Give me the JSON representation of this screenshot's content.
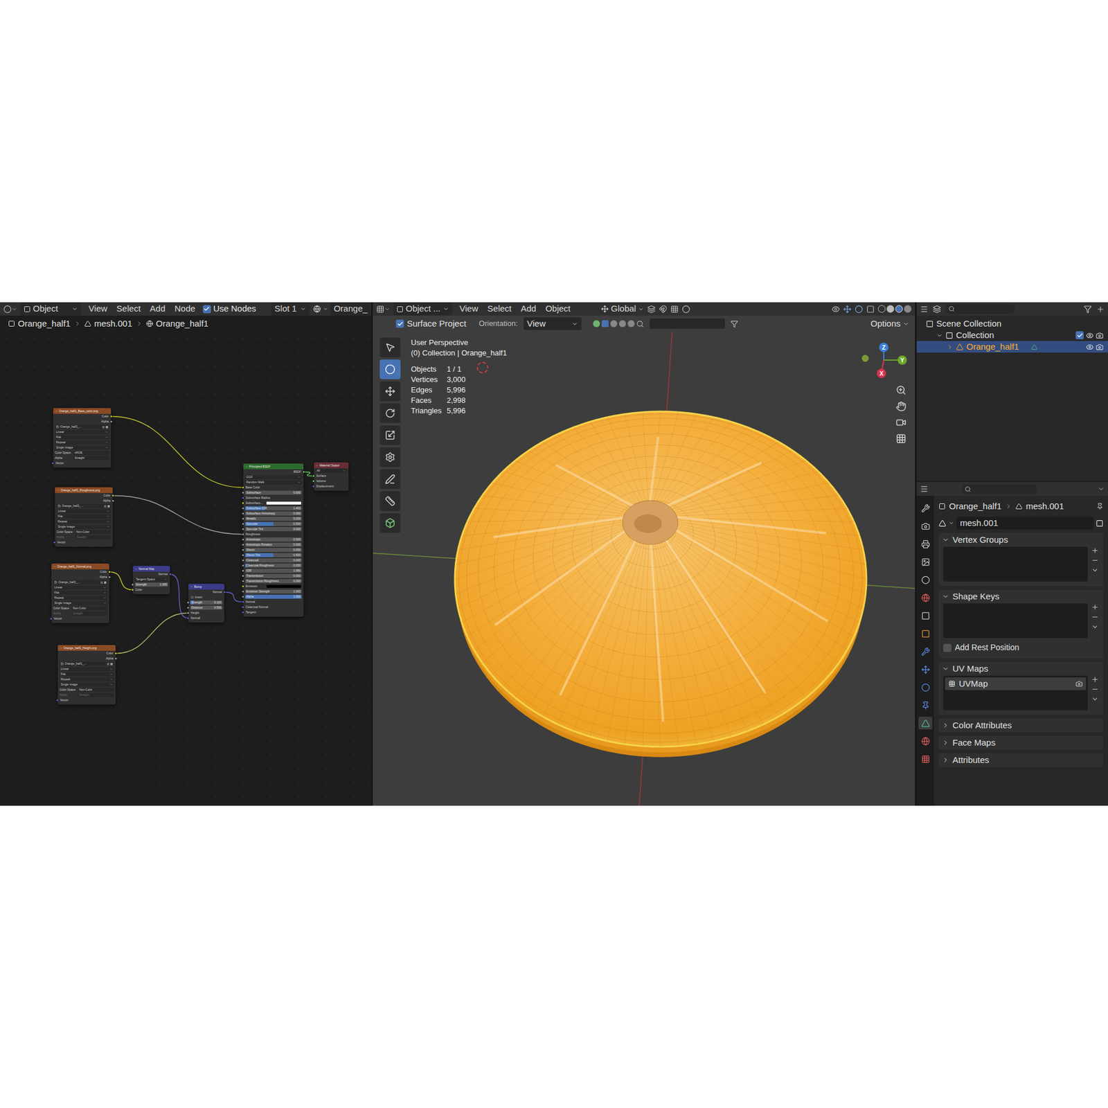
{
  "node_editor": {
    "header": {
      "mode": "Object",
      "menus": [
        "View",
        "Select",
        "Add",
        "Node"
      ],
      "use_nodes": {
        "label": "Use Nodes",
        "checked": true
      },
      "slot": "Slot 1",
      "material": "Orange_"
    },
    "breadcrumb": [
      "Orange_half1",
      "mesh.001",
      "Orange_half1"
    ],
    "nodes": [
      {
        "title": "Orange_half1_Base_color.png",
        "color": "#8a4a24",
        "rows": [
          {
            "kind": "out",
            "text": "Color",
            "color": "#c7c729"
          },
          {
            "kind": "out",
            "text": "Alpha",
            "color": "#a1a1a1"
          },
          {
            "kind": "file",
            "text": "Orange_half1_..."
          },
          {
            "kind": "dropdown",
            "text": "Linear"
          },
          {
            "kind": "dropdown",
            "text": "Flat"
          },
          {
            "kind": "dropdown",
            "text": "Repeat"
          },
          {
            "kind": "dropdown",
            "text": "Single Image"
          },
          {
            "kind": "select",
            "text": "Color Space",
            "value": "sRGB",
            "disabled": false
          },
          {
            "kind": "select",
            "text": "Alpha",
            "value": "Straight",
            "disabled": false
          },
          {
            "kind": "in",
            "text": "Vector",
            "color": "#6363c7"
          }
        ]
      },
      {
        "title": "Orange_half1_Roughness.png",
        "color": "#8a4a24",
        "rows": [
          {
            "kind": "out",
            "text": "Color",
            "color": "#c7c729"
          },
          {
            "kind": "out",
            "text": "Alpha",
            "color": "#a1a1a1"
          },
          {
            "kind": "file",
            "text": "Orange_half1_..."
          },
          {
            "kind": "dropdown",
            "text": "Linear"
          },
          {
            "kind": "dropdown",
            "text": "Flat"
          },
          {
            "kind": "dropdown",
            "text": "Repeat"
          },
          {
            "kind": "dropdown",
            "text": "Single Image"
          },
          {
            "kind": "select",
            "text": "Color Space",
            "value": "Non-Color",
            "disabled": false
          },
          {
            "kind": "select",
            "text": "Alpha",
            "value": "Straight",
            "disabled": true
          },
          {
            "kind": "in",
            "text": "Vector",
            "color": "#6363c7"
          }
        ]
      },
      {
        "title": "Orange_half1_Normal.png",
        "color": "#8a4a24",
        "rows": [
          {
            "kind": "out",
            "text": "Color",
            "color": "#c7c729"
          },
          {
            "kind": "out",
            "text": "Alpha",
            "color": "#a1a1a1"
          },
          {
            "kind": "file",
            "text": "Orange_half1_..."
          },
          {
            "kind": "dropdown",
            "text": "Linear"
          },
          {
            "kind": "dropdown",
            "text": "Flat"
          },
          {
            "kind": "dropdown",
            "text": "Repeat"
          },
          {
            "kind": "dropdown",
            "text": "Single Image"
          },
          {
            "kind": "select",
            "text": "Color Space",
            "value": "Non-Color",
            "disabled": false
          },
          {
            "kind": "select",
            "text": "Alpha",
            "value": "Straight",
            "disabled": true
          },
          {
            "kind": "in",
            "text": "Vector",
            "color": "#6363c7"
          }
        ]
      },
      {
        "title": "Orange_half1_Height.png",
        "color": "#8a4a24",
        "rows": [
          {
            "kind": "out",
            "text": "Color",
            "color": "#c7c729"
          },
          {
            "kind": "out",
            "text": "Alpha",
            "color": "#a1a1a1"
          },
          {
            "kind": "file",
            "text": "Orange_half1_..."
          },
          {
            "kind": "dropdown",
            "text": "Linear"
          },
          {
            "kind": "dropdown",
            "text": "Flat"
          },
          {
            "kind": "dropdown",
            "text": "Repeat"
          },
          {
            "kind": "dropdown",
            "text": "Single Image"
          },
          {
            "kind": "select",
            "text": "Color Space",
            "value": "Non-Color",
            "disabled": false
          },
          {
            "kind": "select",
            "text": "Alpha",
            "value": "Straight",
            "disabled": true
          },
          {
            "kind": "in",
            "text": "Vector",
            "color": "#6363c7"
          }
        ]
      },
      {
        "title": "Normal Map",
        "color": "#3b3b8a",
        "rows": [
          {
            "kind": "out",
            "text": "Normal",
            "color": "#6363c7"
          },
          {
            "kind": "dropdown",
            "text": "Tangent Space"
          },
          {
            "kind": "prop",
            "text": "Strength",
            "value": "1.000",
            "level": 0,
            "color": "#a1a1a1"
          },
          {
            "kind": "in",
            "text": "Color",
            "color": "#c7c729"
          }
        ]
      },
      {
        "title": "Bump",
        "color": "#3b3b8a",
        "rows": [
          {
            "kind": "out",
            "text": "Normal",
            "color": "#6363c7"
          },
          {
            "kind": "check",
            "text": "Invert",
            "checked": false
          },
          {
            "kind": "prop",
            "text": "Strength",
            "value": "0.100",
            "level": 0.1,
            "color": "#a1a1a1"
          },
          {
            "kind": "prop",
            "text": "Distance",
            "value": "0.500",
            "level": 0,
            "color": "#a1a1a1"
          },
          {
            "kind": "in",
            "text": "Height",
            "color": "#a1a1a1"
          },
          {
            "kind": "in",
            "text": "Normal",
            "color": "#6363c7"
          }
        ]
      },
      {
        "title": "Principled BSDF",
        "color": "#2d6a2d",
        "rows": [
          {
            "kind": "out",
            "text": "BSDF",
            "color": "#63c763"
          },
          {
            "kind": "dropdown",
            "text": "GGX"
          },
          {
            "kind": "dropdown",
            "text": "Random Walk"
          },
          {
            "kind": "in",
            "text": "Base Color",
            "color": "#c7c729"
          },
          {
            "kind": "prop",
            "text": "Subsurface",
            "value": "0.000",
            "level": 0,
            "color": "#a1a1a1"
          },
          {
            "kind": "in",
            "text": "Subsurface Radius",
            "color": "#6363c7"
          },
          {
            "kind": "swatch",
            "text": "Subsurface...",
            "swatch": "#ffffff",
            "color": "#c7c729"
          },
          {
            "kind": "prop",
            "text": "Subsurface IOR",
            "value": "1.400",
            "level": 0.35,
            "color": "#a1a1a1"
          },
          {
            "kind": "prop",
            "text": "Subsurface Anisotropy",
            "value": "0.000",
            "level": 0,
            "color": "#a1a1a1"
          },
          {
            "kind": "prop",
            "text": "Metallic",
            "value": "0.000",
            "level": 0,
            "color": "#a1a1a1"
          },
          {
            "kind": "prop",
            "text": "Specular",
            "value": "0.500",
            "level": 0.5,
            "color": "#a1a1a1"
          },
          {
            "kind": "prop",
            "text": "Specular Tint",
            "value": "0.000",
            "level": 0,
            "color": "#a1a1a1"
          },
          {
            "kind": "in",
            "text": "Roughness",
            "color": "#a1a1a1"
          },
          {
            "kind": "prop",
            "text": "Anisotropic",
            "value": "0.000",
            "level": 0,
            "color": "#a1a1a1"
          },
          {
            "kind": "prop",
            "text": "Anisotropic Rotation",
            "value": "0.000",
            "level": 0,
            "color": "#a1a1a1"
          },
          {
            "kind": "prop",
            "text": "Sheen",
            "value": "0.000",
            "level": 0,
            "color": "#a1a1a1"
          },
          {
            "kind": "prop",
            "text": "Sheen Tint",
            "value": "0.500",
            "level": 0.5,
            "color": "#a1a1a1"
          },
          {
            "kind": "prop",
            "text": "Clearcoat",
            "value": "0.000",
            "level": 0,
            "color": "#a1a1a1"
          },
          {
            "kind": "prop",
            "text": "Clearcoat Roughness",
            "value": "0.030",
            "level": 0.03,
            "color": "#a1a1a1"
          },
          {
            "kind": "prop",
            "text": "IOR",
            "value": "1.450",
            "level": 0,
            "color": "#a1a1a1"
          },
          {
            "kind": "prop",
            "text": "Transmission",
            "value": "0.000",
            "level": 0,
            "color": "#a1a1a1"
          },
          {
            "kind": "prop",
            "text": "Transmission Roughness",
            "value": "0.000",
            "level": 0,
            "color": "#a1a1a1"
          },
          {
            "kind": "swatch",
            "text": "Emission",
            "swatch": "#000000",
            "color": "#c7c729"
          },
          {
            "kind": "prop",
            "text": "Emission Strength",
            "value": "1.000",
            "level": 0,
            "color": "#a1a1a1"
          },
          {
            "kind": "prop",
            "text": "Alpha",
            "value": "1.000",
            "level": 1,
            "color": "#a1a1a1"
          },
          {
            "kind": "in",
            "text": "Normal",
            "color": "#6363c7"
          },
          {
            "kind": "in",
            "text": "Clearcoat Normal",
            "color": "#6363c7"
          },
          {
            "kind": "in",
            "text": "Tangent",
            "color": "#6363c7"
          }
        ]
      },
      {
        "title": "Material Output",
        "color": "#6a2d35",
        "rows": [
          {
            "kind": "dropdown",
            "text": "All"
          },
          {
            "kind": "in",
            "text": "Surface",
            "color": "#63c763"
          },
          {
            "kind": "in",
            "text": "Volume",
            "color": "#63c763"
          },
          {
            "kind": "in",
            "text": "Displacement",
            "color": "#6363c7"
          }
        ]
      }
    ]
  },
  "viewport": {
    "header": {
      "mode": "Object ...",
      "menus": [
        "View",
        "Select",
        "Add",
        "Object"
      ],
      "orientation": "Global"
    },
    "tool_settings": {
      "surface_project": {
        "label": "Surface Project",
        "checked": true
      },
      "orientation_label": "Orientation:",
      "orientation": "View",
      "options": "Options"
    },
    "overlay": {
      "title": "User Perspective",
      "collection": "(0) Collection | Orange_half1",
      "stats": [
        {
          "label": "Objects",
          "value": "1 / 1"
        },
        {
          "label": "Vertices",
          "value": "3,000"
        },
        {
          "label": "Edges",
          "value": "5,996"
        },
        {
          "label": "Faces",
          "value": "2,998"
        },
        {
          "label": "Triangles",
          "value": "5,996"
        }
      ]
    },
    "gizmo": [
      {
        "label": "Z",
        "color": "#3f7fd8"
      },
      {
        "label": "Y",
        "color": "#6aa829"
      },
      {
        "label": "X",
        "color": "#d8344f"
      }
    ],
    "tools": [
      {
        "name": "select-box",
        "selected": false
      },
      {
        "name": "cursor",
        "selected": true
      },
      {
        "name": "move",
        "selected": false
      },
      {
        "name": "rotate",
        "selected": false
      },
      {
        "name": "scale",
        "selected": false
      },
      {
        "name": "transform",
        "selected": false
      },
      {
        "name": "annotate",
        "selected": false
      },
      {
        "name": "measure",
        "selected": false
      },
      {
        "name": "add-cube",
        "selected": false
      }
    ]
  },
  "outliner": {
    "items": [
      {
        "label": "Scene Collection",
        "level": 0,
        "selected": false,
        "expanded": true,
        "kind": "scene"
      },
      {
        "label": "Collection",
        "level": 1,
        "selected": false,
        "expanded": true,
        "kind": "collection",
        "checked": true
      },
      {
        "label": "Orange_half1",
        "level": 2,
        "selected": true,
        "expanded": false,
        "kind": "object"
      }
    ]
  },
  "properties": {
    "breadcrumb": [
      "Orange_half1",
      "mesh.001"
    ],
    "mesh_name": "mesh.001",
    "panels": [
      {
        "label": "Vertex Groups",
        "expanded": true,
        "kind": "list",
        "items": []
      },
      {
        "label": "Shape Keys",
        "expanded": true,
        "kind": "list",
        "items": [],
        "checkbox": {
          "label": "Add Rest Position",
          "checked": false
        }
      },
      {
        "label": "UV Maps",
        "expanded": true,
        "kind": "list",
        "items": [
          {
            "label": "UVMap",
            "selected": true
          }
        ]
      },
      {
        "label": "Color Attributes",
        "expanded": false,
        "kind": "closed",
        "items": []
      },
      {
        "label": "Face Maps",
        "expanded": false,
        "kind": "closed",
        "items": []
      },
      {
        "label": "Attributes",
        "expanded": false,
        "kind": "closed",
        "items": []
      }
    ]
  }
}
